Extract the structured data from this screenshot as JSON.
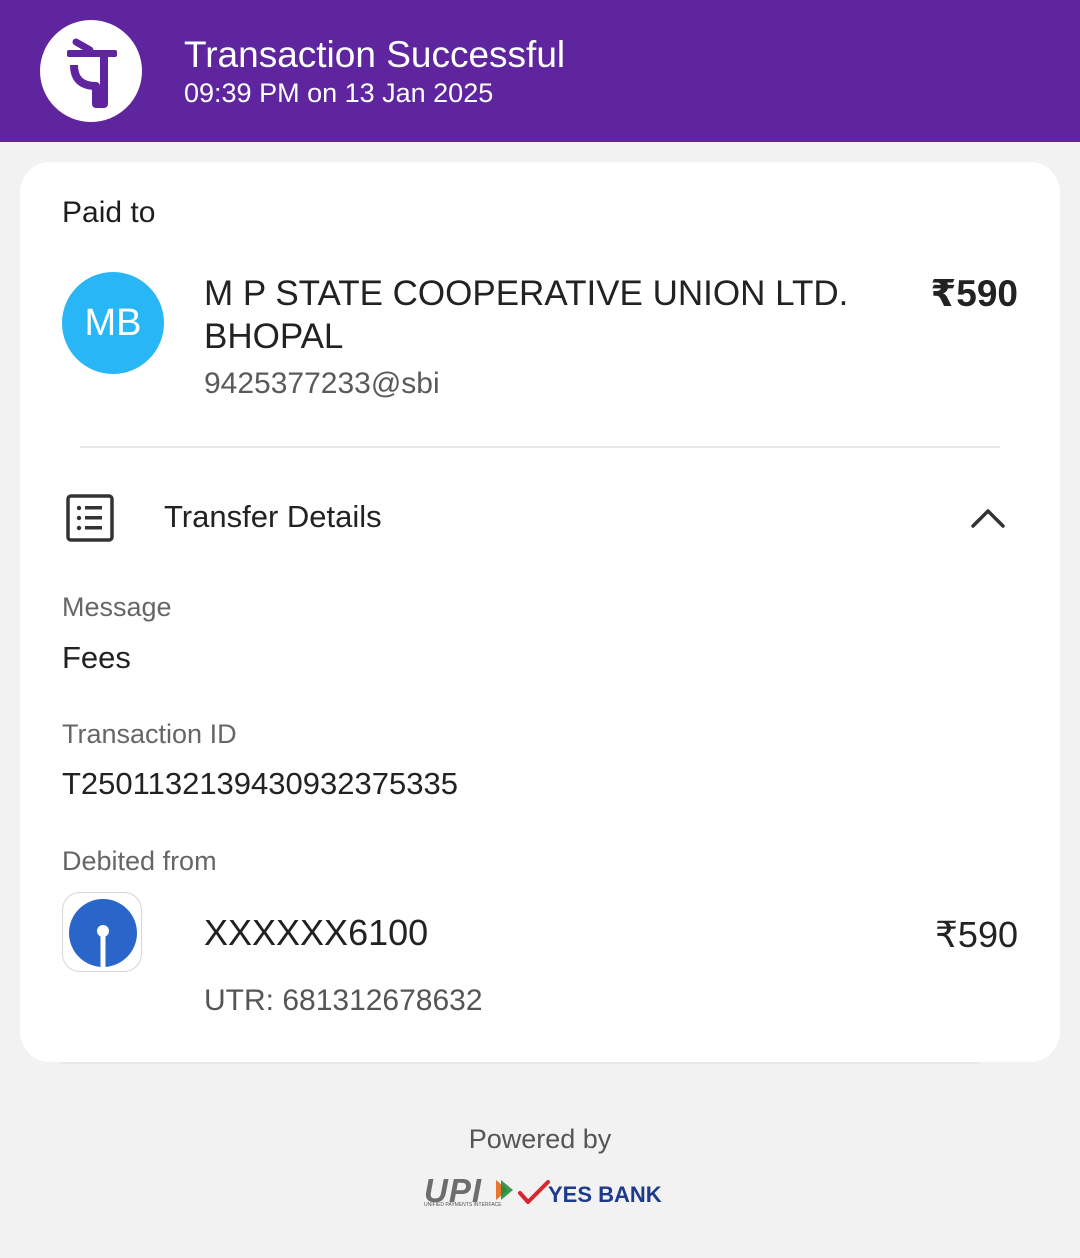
{
  "header": {
    "title": "Transaction Successful",
    "subtitle": "09:39 PM on 13 Jan 2025",
    "logo_icon": "phonepe-logo-icon",
    "background": "#5f259f"
  },
  "payment": {
    "paid_to_label": "Paid to",
    "avatar_initials": "MB",
    "avatar_color": "#29b6f6",
    "payee_name": "M P STATE COOPERATIVE UNION LTD. BHOPAL",
    "payee_vpa": "9425377233@sbi",
    "amount": "₹590"
  },
  "transfer_details": {
    "title": "Transfer Details",
    "icon": "receipt-list-icon",
    "toggle_icon": "chevron-up-icon",
    "message_label": "Message",
    "message_value": "Fees",
    "transaction_id_label": "Transaction ID",
    "transaction_id_value": "T2501132139430932375335",
    "debited_from_label": "Debited from",
    "bank_icon": "sbi-bank-logo-icon",
    "account_number": "XXXXXX6100",
    "account_amount": "₹590",
    "utr": "UTR: 681312678632"
  },
  "footer": {
    "powered_by": "Powered by",
    "upi_label": "UPI",
    "upi_subtext": "UNIFIED PAYMENTS INTERFACE",
    "bank_label": "YES BANK"
  }
}
